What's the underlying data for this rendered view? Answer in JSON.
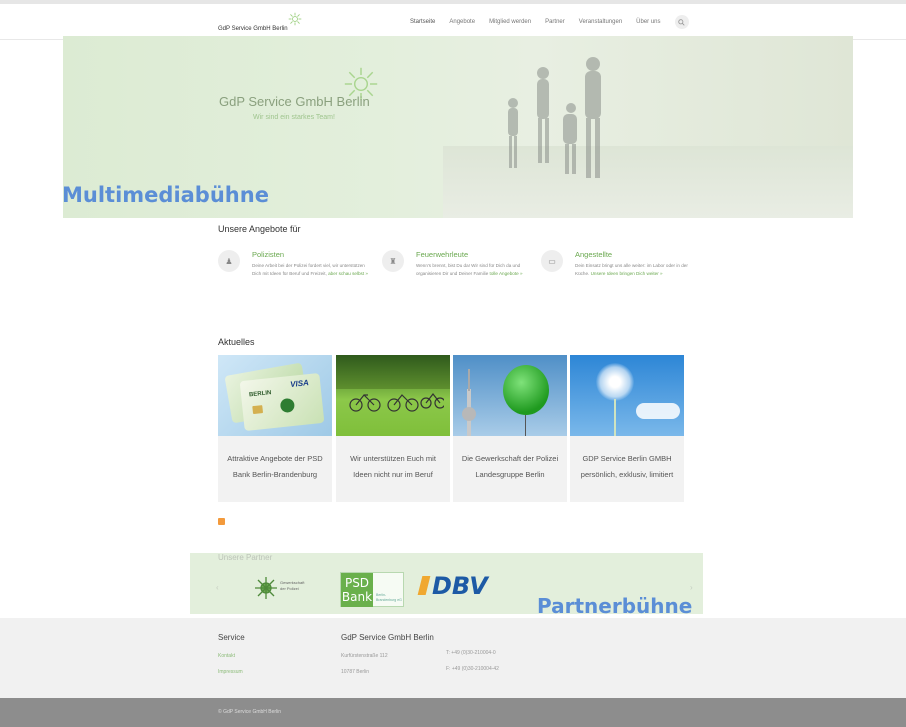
{
  "header": {
    "brand": "GdP Service GmbH Berlin",
    "nav": [
      "Startseite",
      "Angebote",
      "Mitglied werden",
      "Partner",
      "Veranstaltungen",
      "Über uns"
    ]
  },
  "hero": {
    "title": "GdP Service GmbH Berlin",
    "subtitle": "Wir sind ein starkes Team!",
    "label": "Multimediabühne"
  },
  "offers": {
    "heading": "Unsere Angebote für",
    "items": [
      {
        "title": "Polizisten",
        "text": "Deine Arbeit bei der Polizei fordert viel, wir unterstützen Dich mit Ideen für Beruf und Freizeit,",
        "link": "aber schau selbst »"
      },
      {
        "title": "Feuerwehrleute",
        "text": "Wenn's brennt, bist Du da! Wir sind für Dich da und organisieren Dir und Deiner Familie",
        "link": "tolle Angebote »"
      },
      {
        "title": "Angestellte",
        "text": "Dein Einsatz bringt uns alle weiter: im Labor oder in der Küche.",
        "link": "Unsere Ideen bringen Dich weiter »"
      }
    ]
  },
  "news": {
    "heading": "Aktuelles",
    "cards": [
      {
        "caption": "Attraktive Angebote der PSD Bank Berlin-Brandenburg"
      },
      {
        "caption": "Wir unterstützen Euch mit Ideen nicht nur im Beruf"
      },
      {
        "caption": "Die Gewerkschaft der Polizei Landesgruppe Berlin"
      },
      {
        "caption": "GDP Service Berlin GMBH persönlich, exklusiv, limitiert"
      }
    ],
    "card1_text": {
      "brand": "VISA",
      "city": "BERLIN"
    }
  },
  "partners": {
    "heading": "Unsere Partner",
    "gdp": "Gewerkschaft der Polizei",
    "psd": "PSD Bank",
    "psd_sub": "Berlin-Brandenburg eG",
    "dbv": "DBV",
    "label": "Partnerbühne"
  },
  "footer": {
    "service_heading": "Service",
    "links": [
      "Kontakt",
      "Impressum"
    ],
    "company_heading": "GdP Service GmbH Berlin",
    "street": "Kurfürstenstraße 112",
    "city": "10787 Berlin",
    "phone": "T: +49 (0)30-210004-0",
    "fax": "F: +49 (0)30-210004-42",
    "copyright": "© GdP Service GmbH Berlin"
  }
}
